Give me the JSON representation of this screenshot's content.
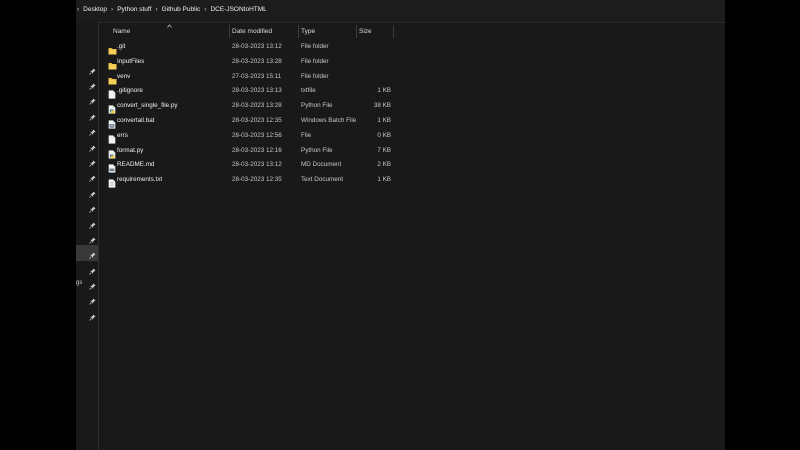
{
  "breadcrumb": [
    "Desktop",
    "Python stuff",
    "Github Public",
    "DCE-JSONtoHTML"
  ],
  "columns": {
    "name": "Name",
    "date": "Date modified",
    "type": "Type",
    "size": "Size"
  },
  "nav_partial_label": "gs",
  "files": [
    {
      "name": ".git",
      "date": "28-03-2023 13:12",
      "type": "File folder",
      "size": "",
      "icon": "folder-icon"
    },
    {
      "name": "InputFiles",
      "date": "28-03-2023 13:28",
      "type": "File folder",
      "size": "",
      "icon": "folder-icon"
    },
    {
      "name": "venv",
      "date": "27-03-2023 15:11",
      "type": "File folder",
      "size": "",
      "icon": "folder-icon"
    },
    {
      "name": ".gitignore",
      "date": "28-03-2023 13:13",
      "type": "txtfile",
      "size": "1 KB",
      "icon": "document-icon"
    },
    {
      "name": "convert_single_file.py",
      "date": "28-03-2023 13:28",
      "type": "Python File",
      "size": "38 KB",
      "icon": "python-file-icon"
    },
    {
      "name": "convertall.bat",
      "date": "28-03-2023 12:35",
      "type": "Windows Batch File",
      "size": "1 KB",
      "icon": "batch-file-icon"
    },
    {
      "name": "errs",
      "date": "28-03-2023 12:56",
      "type": "File",
      "size": "0 KB",
      "icon": "document-icon"
    },
    {
      "name": "format.py",
      "date": "28-03-2023 12:16",
      "type": "Python File",
      "size": "7 KB",
      "icon": "python-file-icon"
    },
    {
      "name": "README.md",
      "date": "28-03-2023 13:12",
      "type": "MD Document",
      "size": "2 KB",
      "icon": "markdown-file-icon"
    },
    {
      "name": "requirements.txt",
      "date": "28-03-2023 12:35",
      "type": "Text Document",
      "size": "1 KB",
      "icon": "text-file-icon"
    }
  ]
}
